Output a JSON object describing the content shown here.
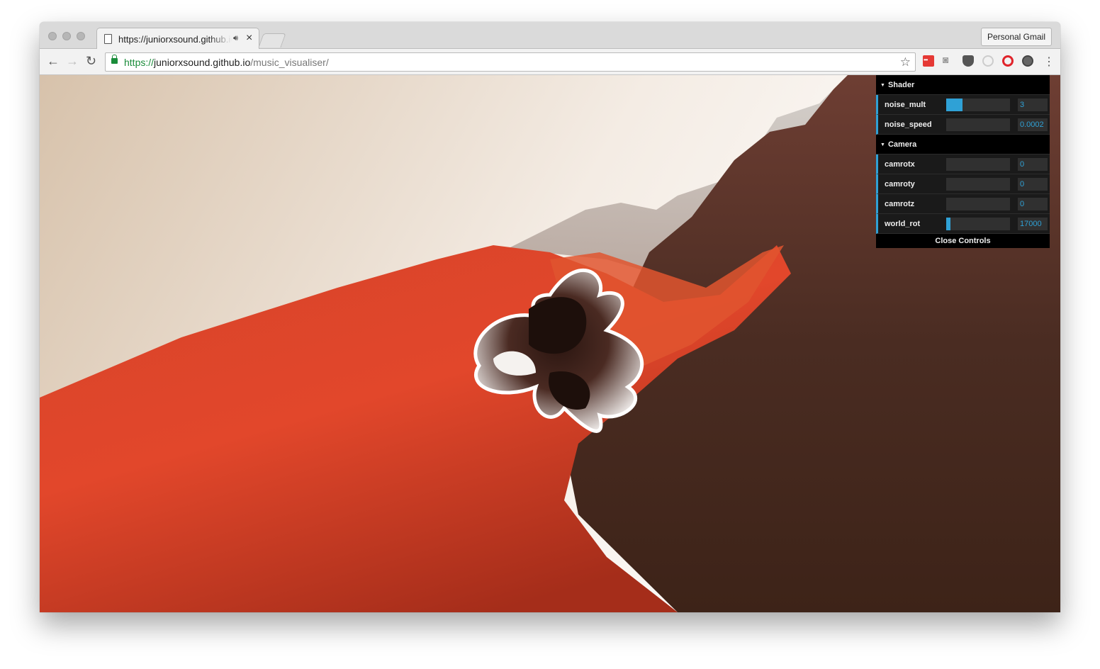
{
  "browser": {
    "tab_title": "https://juniorxsound.github.io/music_visualiser/",
    "profile_label": "Personal Gmail",
    "url_scheme": "https://",
    "url_host": "juniorxsound.github.io",
    "url_path": "/music_visualiser/",
    "icons": [
      "back-arrow-icon",
      "forward-arrow-icon",
      "reload-icon",
      "lock-icon",
      "star-icon",
      "kebab-menu-icon"
    ]
  },
  "gui": {
    "shader_title": "Shader",
    "camera_title": "Camera",
    "close_label": "Close Controls",
    "shader_controls": [
      {
        "label": "noise_mult",
        "value": "3",
        "fill": 0.25
      },
      {
        "label": "noise_speed",
        "value": "0.0002",
        "fill": 0.0
      }
    ],
    "camera_controls": [
      {
        "label": "camrotx",
        "value": "0",
        "fill": 0.0
      },
      {
        "label": "camroty",
        "value": "0",
        "fill": 0.0
      },
      {
        "label": "camrotz",
        "value": "0",
        "fill": 0.0
      },
      {
        "label": "world_rot",
        "value": "17000",
        "fill": 0.07
      }
    ],
    "accent": "#2fa1d6"
  }
}
